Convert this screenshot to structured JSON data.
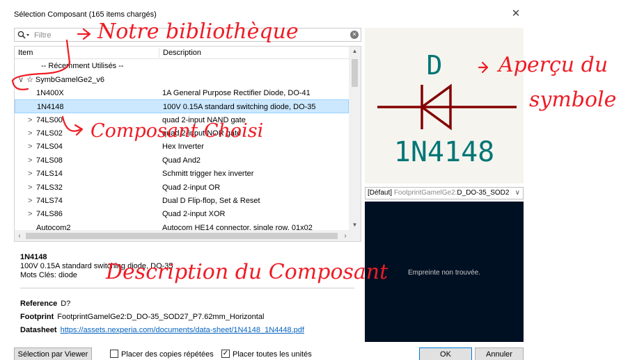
{
  "window": {
    "title": "Sélection Composant (165 items chargés)",
    "close_label": "✕"
  },
  "search": {
    "placeholder": "Filtre",
    "icon": "search-icon",
    "clear_icon": "clear-icon"
  },
  "tree": {
    "columns": [
      "Item",
      "Description"
    ],
    "rows": [
      {
        "name": "-- Récemment Utilisés --",
        "desc": "",
        "expand": "",
        "kind": "group"
      },
      {
        "name": "☆ SymbGamelGe2_v6",
        "desc": "",
        "expand": "∨",
        "kind": "group"
      },
      {
        "name": "1N400X",
        "desc": "1A General Purpose Rectifier Diode, DO-41",
        "expand": "",
        "kind": "item"
      },
      {
        "name": "1N4148",
        "desc": "100V 0.15A standard switching diode, DO-35",
        "expand": "",
        "kind": "item",
        "selected": true
      },
      {
        "name": "74LS00",
        "desc": "quad 2-input NAND gate",
        "expand": ">",
        "kind": "item"
      },
      {
        "name": "74LS02",
        "desc": "quad 2-input NOR gate",
        "expand": ">",
        "kind": "item"
      },
      {
        "name": "74LS04",
        "desc": "Hex Inverter",
        "expand": ">",
        "kind": "item"
      },
      {
        "name": "74LS08",
        "desc": "Quad And2",
        "expand": ">",
        "kind": "item"
      },
      {
        "name": "74LS14",
        "desc": "Schmitt trigger hex inverter",
        "expand": ">",
        "kind": "item"
      },
      {
        "name": "74LS32",
        "desc": "Quad 2-input OR",
        "expand": ">",
        "kind": "item"
      },
      {
        "name": "74LS74",
        "desc": "Dual D Flip-flop, Set & Reset",
        "expand": ">",
        "kind": "item"
      },
      {
        "name": "74LS86",
        "desc": "Quad 2-input XOR",
        "expand": ">",
        "kind": "item"
      },
      {
        "name": "Autocom2",
        "desc": "Autocom HE14 connector, single row, 01x02",
        "expand": "",
        "kind": "item"
      }
    ]
  },
  "details": {
    "name": "1N4148",
    "description": "100V 0.15A standard switching diode, DO-35",
    "keywords": "Mots Clés: diode",
    "reference_label": "Reference",
    "reference_value": "D?",
    "footprint_label": "Footprint",
    "footprint_value": "FootprintGamelGe2:D_DO-35_SOD27_P7.62mm_Horizontal",
    "datasheet_label": "Datasheet",
    "datasheet_url": "https://assets.nexperia.com/documents/data-sheet/1N4148_1N4448.pdf"
  },
  "symbol_preview": {
    "ref": "D",
    "value": "1N4148",
    "color_body": "#840000",
    "color_text": "#007575"
  },
  "footprint": {
    "select_prefix": "[Défaut]",
    "select_lib": "FootprintGamelGe2:",
    "select_value": "D_DO-35_SOD2",
    "not_found": "Empreinte non trouvée."
  },
  "footer": {
    "viewer_button": "Sélection par Viewer",
    "repeat_copies": "Placer des copies répétées",
    "repeat_checked": false,
    "all_units": "Placer toutes les unités",
    "all_units_checked": true,
    "ok": "OK",
    "cancel": "Annuler"
  },
  "annotations": {
    "library": "Notre bibliothèque",
    "chosen": "Composant Choisi",
    "description": "Description du Composant",
    "preview_line1": "Aperçu du",
    "preview_line2": "symbole",
    "color": "#ee1c25"
  }
}
